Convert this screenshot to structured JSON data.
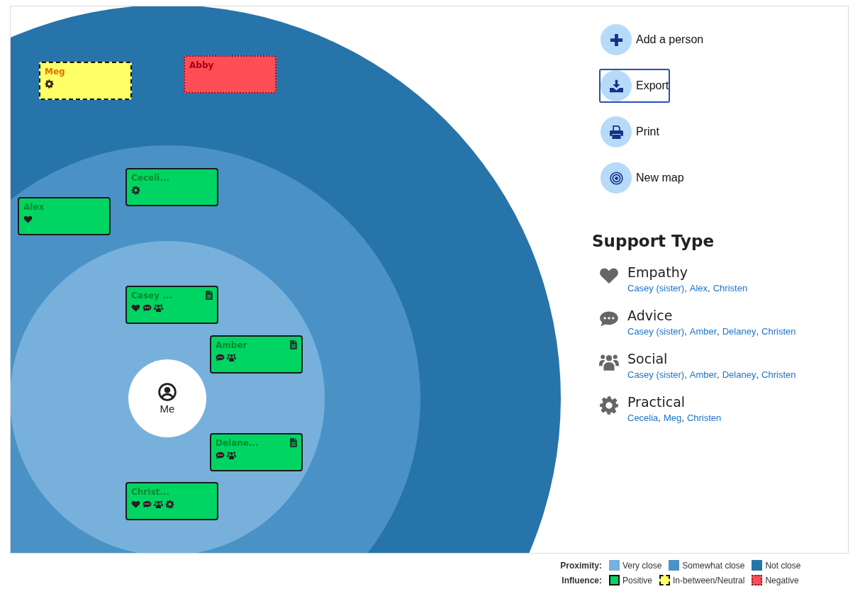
{
  "map": {
    "center": {
      "label": "Me"
    },
    "people": [
      {
        "name": "Meg",
        "kind": "neutral",
        "supports": [
          {
            "kind": "practical"
          }
        ],
        "has_note": false
      },
      {
        "name": "Abby",
        "kind": "negative",
        "has_note": false
      },
      {
        "name": "Ceceli...",
        "kind": "positive",
        "supports": [
          {
            "kind": "practical"
          }
        ],
        "has_note": false
      },
      {
        "name": "Alex",
        "kind": "positive",
        "supports": [
          {
            "kind": "empathy"
          }
        ],
        "has_note": false
      },
      {
        "name": "Casey ...",
        "kind": "positive",
        "supports": [
          {
            "kind": "empathy"
          },
          {
            "kind": "advice"
          },
          {
            "kind": "social"
          }
        ],
        "has_note": true
      },
      {
        "name": "Amber",
        "kind": "positive",
        "supports": [
          {
            "kind": "advice"
          },
          {
            "kind": "social"
          }
        ],
        "has_note": true
      },
      {
        "name": "Delane...",
        "kind": "positive",
        "supports": [
          {
            "kind": "advice"
          },
          {
            "kind": "social"
          }
        ],
        "has_note": true
      },
      {
        "name": "Christ...",
        "kind": "positive",
        "supports": [
          {
            "kind": "empathy"
          },
          {
            "kind": "advice"
          },
          {
            "kind": "social"
          },
          {
            "kind": "practical"
          }
        ],
        "has_note": false
      }
    ]
  },
  "actions": [
    {
      "kind": "add",
      "label": "Add a person",
      "focused": false
    },
    {
      "kind": "export",
      "label": "Export",
      "focused": true
    },
    {
      "kind": "print",
      "label": "Print",
      "focused": false
    },
    {
      "kind": "newmap",
      "label": "New map",
      "focused": false
    }
  ],
  "support_types": {
    "title": "Support Type",
    "separator": ",",
    "items": [
      {
        "kind": "empathy",
        "label": "Empathy",
        "people": [
          "Casey (sister)",
          "Alex",
          "Christen"
        ]
      },
      {
        "kind": "advice",
        "label": "Advice",
        "people": [
          "Casey (sister)",
          "Amber",
          "Delaney",
          "Christen"
        ]
      },
      {
        "kind": "social",
        "label": "Social",
        "people": [
          "Casey (sister)",
          "Amber",
          "Delaney",
          "Christen"
        ]
      },
      {
        "kind": "practical",
        "label": "Practical",
        "people": [
          "Cecelia",
          "Meg",
          "Christen"
        ]
      }
    ]
  },
  "legend": {
    "proximity": {
      "label": "Proximity:",
      "items": [
        {
          "label": "Very close",
          "color": "#78b0dc"
        },
        {
          "label": "Somewhat close",
          "color": "#4a92c6"
        },
        {
          "label": "Not close",
          "color": "#2774aa"
        }
      ]
    },
    "influence": {
      "label": "Influence:",
      "items": [
        {
          "kind": "positive",
          "label": "Positive"
        },
        {
          "kind": "neutral",
          "label": "In-between/Neutral"
        },
        {
          "kind": "negative",
          "label": "Negative"
        }
      ]
    }
  }
}
